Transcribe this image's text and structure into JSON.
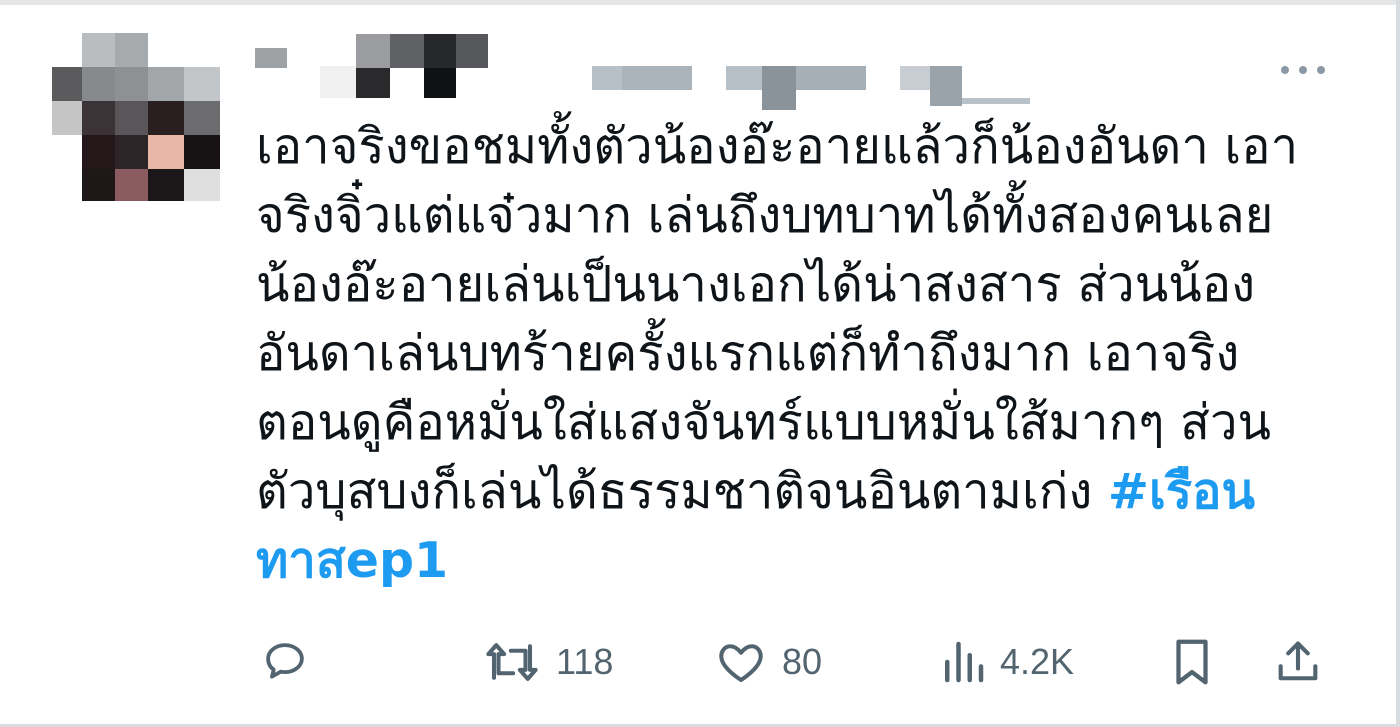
{
  "tweet": {
    "text_lines": [
      "เอาจริงขอชมทั้งตัวน้องอ๊ะอายแล้วก็น้องอันดา เอา",
      "จริงจิ๋วแต่แจ๋วมาก เล่นถึงบทบาทได้ทั้งสองคนเลย",
      "น้องอ๊ะอายเล่นเป็นนางเอกได้น่าสงสาร ส่วนน้อง",
      "อันดาเล่นบทร้ายครั้งแรกแต่ก็ทำถึงมาก เอาจริง",
      "ตอนดูคือหมั่นใส่แสงจันทร์แบบหมั่นใส้มากๆ ส่วน"
    ],
    "line6_text": "ตัวบุสบงก็เล่นได้ธรรมชาติจนอินตามเก่ง ",
    "hashtag_part1": "#เรือน",
    "hashtag_part2": "ทาสep1",
    "accent_color": "#1d9bf0",
    "text_color": "#0f1419",
    "muted_color": "#536471"
  },
  "actions": {
    "reply": {
      "icon": "reply-icon"
    },
    "retweet": {
      "icon": "retweet-icon",
      "count": "118"
    },
    "like": {
      "icon": "heart-icon",
      "count": "80"
    },
    "views": {
      "icon": "views-chart-icon",
      "count": "4.2K"
    },
    "bookmark": {
      "icon": "bookmark-icon"
    },
    "share": {
      "icon": "share-icon"
    }
  },
  "header": {
    "more_icon": "more-dots-icon"
  }
}
